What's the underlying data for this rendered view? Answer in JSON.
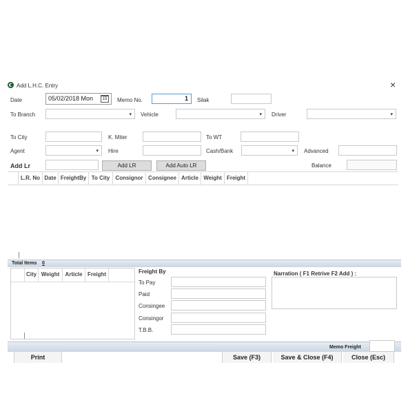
{
  "window": {
    "title": "Add L.H.C. Entry",
    "close_glyph": "×"
  },
  "row1": {
    "date_label": "Date",
    "date_value": "05/02/2018 Mon",
    "calendar_day": "15",
    "memo_label": "Memo No.",
    "memo_value": "1",
    "silak_label": "Silak"
  },
  "row2": {
    "to_branch_label": "To Branch",
    "vehicle_label": "Vehicle",
    "driver_label": "Driver"
  },
  "row3": {
    "to_city_label": "To City",
    "k_miter_label": "K. Miter",
    "to_wt_label": "To WT"
  },
  "row4": {
    "agent_label": "Agent",
    "hire_label": "Hire",
    "cash_bank_label": "Cash/Bank",
    "advanced_label": "Advanced"
  },
  "row5": {
    "add_lr_label": "Add Lr",
    "add_lr_button": "Add LR",
    "add_auto_lr_button": "Add Auto LR",
    "balance_label": "Balance"
  },
  "main_grid": {
    "columns": [
      "L.R. No",
      "Date",
      "FreightBy",
      "To City",
      "Consignor",
      "Consignee",
      "Article",
      "Weight",
      "Freight"
    ]
  },
  "totals": {
    "label": "Total Items",
    "count": "0"
  },
  "sub_grid": {
    "columns": [
      "City",
      "Weight",
      "Article",
      "Freight"
    ]
  },
  "freight_by": {
    "heading": "Freight By",
    "rows": [
      "To Pay",
      "Paid",
      "Consingee",
      "Consingor",
      "T.B.B."
    ]
  },
  "narration": {
    "label": "Narration ( F1 Retrive F2 Add ) :"
  },
  "memo_freight": {
    "label": "Memo Freight"
  },
  "footer": {
    "print": "Print",
    "save": "Save (F3)",
    "save_close": "Save & Close (F4)",
    "close": "Close (Esc)"
  },
  "dropdown_glyph": "▾"
}
